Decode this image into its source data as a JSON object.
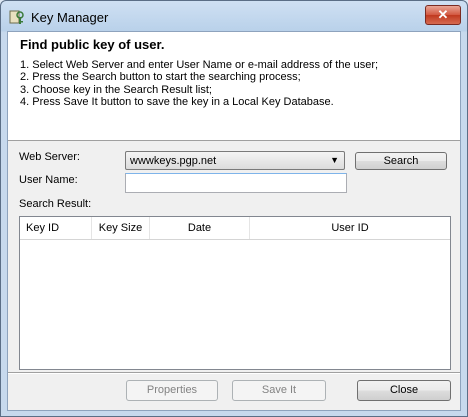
{
  "window": {
    "title": "Key Manager",
    "close_label": "✕"
  },
  "header": {
    "title": "Find public key of user.",
    "instructions": [
      "1. Select Web Server and enter User Name or e-mail address of the user;",
      "2. Press the Search button to start the searching process;",
      "3. Choose key in the Search Result list;",
      "4. Press Save It button to save the key in a Local Key Database."
    ]
  },
  "form": {
    "web_server_label": "Web Server:",
    "web_server_value": "wwwkeys.pgp.net",
    "search_label": "Search",
    "user_name_label": "User Name:",
    "user_name_value": "",
    "search_result_label": "Search Result:"
  },
  "results": {
    "columns": [
      "Key ID",
      "Key Size",
      "Date",
      "User ID"
    ],
    "rows": []
  },
  "footer": {
    "properties_label": "Properties",
    "save_label": "Save It",
    "close_label": "Close"
  },
  "colors": {
    "titlebar": "#cfe0f3",
    "close_button": "#c0391f",
    "input_focus": "#7eb4ea"
  }
}
